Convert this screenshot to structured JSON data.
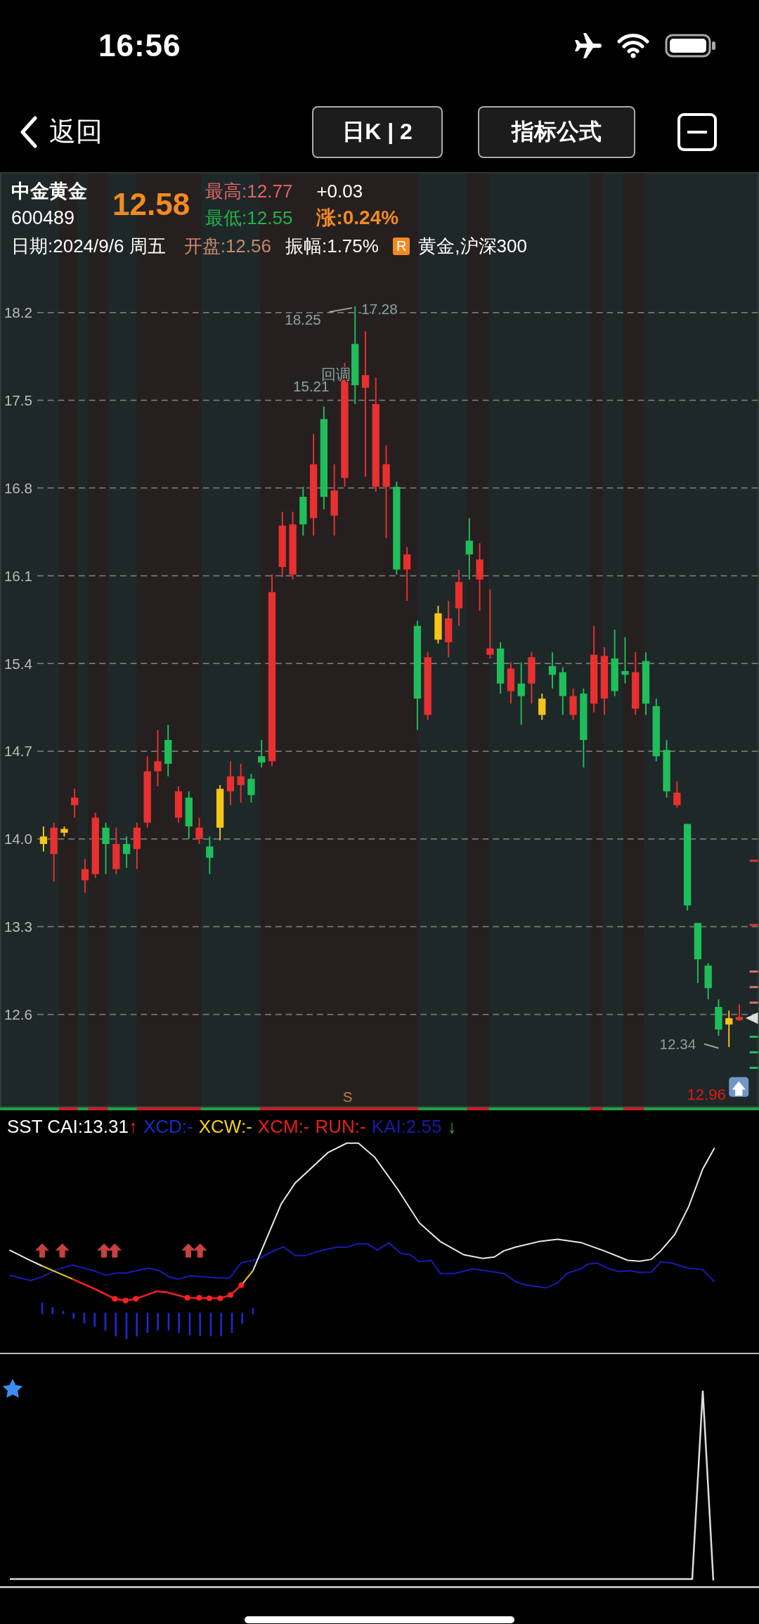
{
  "status_bar": {
    "time": "16:56"
  },
  "nav": {
    "back": "返回",
    "period_button": "日K | 2",
    "formula_button": "指标公式"
  },
  "quote": {
    "name": "中金黄金",
    "code": "600489",
    "price": "12.58",
    "high": "最高:12.77",
    "change": "+0.03",
    "low": "最低:12.55",
    "change_pct": "涨:0.24%",
    "date": "日期:2024/9/6 周五",
    "open": "开盘:12.56",
    "amplitude": "振幅:1.75%",
    "tag": "R",
    "sectors": "黄金,沪深300"
  },
  "price_chart": {
    "annotations": [
      "18.25",
      "17.28",
      "回调",
      "15.21",
      "12.34"
    ],
    "marker": "S",
    "last_label": "12.96",
    "chart_data": {
      "type": "candlestick",
      "yticks": [
        {
          "value": 18.2,
          "label": "18.2"
        },
        {
          "value": 17.5,
          "label": "17.5"
        },
        {
          "value": 16.8,
          "label": "16.8"
        },
        {
          "value": 16.1,
          "label": "16.1"
        },
        {
          "value": 15.4,
          "label": "15.4"
        },
        {
          "value": 14.7,
          "label": "14.7"
        },
        {
          "value": 14,
          "label": "14.0"
        },
        {
          "value": 13.3,
          "label": "13.3"
        },
        {
          "value": 12.6,
          "label": "12.6"
        }
      ],
      "grid": true,
      "ylim": [
        11.86,
        19.32
      ],
      "ohlc": [
        [
          13.96,
          14.1,
          13.9,
          14.02
        ],
        [
          13.88,
          14.13,
          13.66,
          14.09
        ],
        [
          14.05,
          14.1,
          14.02,
          14.08
        ],
        [
          14.27,
          14.4,
          14.17,
          14.33
        ],
        [
          13.67,
          13.84,
          13.57,
          13.76
        ],
        [
          13.72,
          14.21,
          13.69,
          14.17
        ],
        [
          14.09,
          14.13,
          13.72,
          13.96
        ],
        [
          13.76,
          14.09,
          13.72,
          13.96
        ],
        [
          13.96,
          14.02,
          13.77,
          13.88
        ],
        [
          13.92,
          14.13,
          13.76,
          14.09
        ],
        [
          14.13,
          14.66,
          14.09,
          14.54
        ],
        [
          14.54,
          14.87,
          14.42,
          14.62
        ],
        [
          14.79,
          14.91,
          14.5,
          14.6
        ],
        [
          14.17,
          14.42,
          14.13,
          14.38
        ],
        [
          14.33,
          14.38,
          14.0,
          14.1
        ],
        [
          14.0,
          14.17,
          13.96,
          14.09
        ],
        [
          13.94,
          14.02,
          13.72,
          13.85
        ],
        [
          14.09,
          14.43,
          13.99,
          14.4
        ],
        [
          14.38,
          14.62,
          14.27,
          14.5
        ],
        [
          14.43,
          14.6,
          14.29,
          14.5
        ],
        [
          14.48,
          14.52,
          14.29,
          14.35
        ],
        [
          14.66,
          14.79,
          14.57,
          14.61
        ],
        [
          14.62,
          16.11,
          14.58,
          15.97
        ],
        [
          16.17,
          16.61,
          16.09,
          16.5
        ],
        [
          16.11,
          16.61,
          16.07,
          16.51
        ],
        [
          16.73,
          16.81,
          16.42,
          16.51
        ],
        [
          16.56,
          17.23,
          16.42,
          16.99
        ],
        [
          17.35,
          17.45,
          16.63,
          16.73
        ],
        [
          16.58,
          16.99,
          16.42,
          16.78
        ],
        [
          16.88,
          17.8,
          16.81,
          17.7
        ],
        [
          17.95,
          18.25,
          17.47,
          17.62
        ],
        [
          17.6,
          18.05,
          16.89,
          17.7
        ],
        [
          16.81,
          17.68,
          16.77,
          17.47
        ],
        [
          16.81,
          17.14,
          16.4,
          16.99
        ],
        [
          16.81,
          16.85,
          16.11,
          16.15
        ],
        [
          16.15,
          16.33,
          15.9,
          16.27
        ],
        [
          15.7,
          15.74,
          14.87,
          15.12
        ],
        [
          14.99,
          15.49,
          14.95,
          15.45
        ],
        [
          15.59,
          15.86,
          15.56,
          15.8
        ],
        [
          15.57,
          15.9,
          15.45,
          15.76
        ],
        [
          15.84,
          16.15,
          15.7,
          16.05
        ],
        [
          16.38,
          16.56,
          16.07,
          16.27
        ],
        [
          16.07,
          16.36,
          15.82,
          16.23
        ],
        [
          15.47,
          15.99,
          15.44,
          15.52
        ],
        [
          15.52,
          15.57,
          15.16,
          15.24
        ],
        [
          15.18,
          15.41,
          15.08,
          15.36
        ],
        [
          15.24,
          15.41,
          14.91,
          15.14
        ],
        [
          15.24,
          15.49,
          15.08,
          15.45
        ],
        [
          14.99,
          15.16,
          14.95,
          15.12
        ],
        [
          15.38,
          15.49,
          15.2,
          15.31
        ],
        [
          15.33,
          15.37,
          14.99,
          15.14
        ],
        [
          14.99,
          15.2,
          14.95,
          15.14
        ],
        [
          15.16,
          15.2,
          14.57,
          14.79
        ],
        [
          15.08,
          15.7,
          15.01,
          15.47
        ],
        [
          15.12,
          15.53,
          14.99,
          15.46
        ],
        [
          15.44,
          15.67,
          15.14,
          15.18
        ],
        [
          15.34,
          15.61,
          15.24,
          15.31
        ],
        [
          15.04,
          15.49,
          14.99,
          15.33
        ],
        [
          15.42,
          15.49,
          14.99,
          15.08
        ],
        [
          15.06,
          15.12,
          14.62,
          14.66
        ],
        [
          14.71,
          14.79,
          14.33,
          14.38
        ],
        [
          14.27,
          14.46,
          14.25,
          14.37
        ],
        [
          14.12,
          14.12,
          13.43,
          13.47
        ],
        [
          13.33,
          13.33,
          12.85,
          13.04
        ],
        [
          12.99,
          13.01,
          12.72,
          12.81
        ],
        [
          12.66,
          12.72,
          12.43,
          12.48
        ],
        [
          12.52,
          12.63,
          12.34,
          12.57
        ],
        [
          12.56,
          12.68,
          12.55,
          12.58
        ]
      ],
      "colors": [
        "#f5c518",
        "#e83030",
        "#f5c518",
        "#e83030",
        "#e83030",
        "#e83030",
        "#1fbe5a",
        "#e83030",
        "#1fbe5a",
        "#e83030",
        "#e83030",
        "#e83030",
        "#1fbe5a",
        "#e83030",
        "#1fbe5a",
        "#e83030",
        "#1fbe5a",
        "#f5c518",
        "#e83030",
        "#e83030",
        "#1fbe5a",
        "#1fbe5a",
        "#e83030",
        "#e83030",
        "#e83030",
        "#1fbe5a",
        "#e83030",
        "#1fbe5a",
        "#e83030",
        "#e83030",
        "#1fbe5a",
        "#e83030",
        "#e83030",
        "#e83030",
        "#1fbe5a",
        "#e83030",
        "#1fbe5a",
        "#e83030",
        "#f5c518",
        "#e83030",
        "#e83030",
        "#1fbe5a",
        "#e83030",
        "#e83030",
        "#1fbe5a",
        "#e83030",
        "#1fbe5a",
        "#e83030",
        "#f5c518",
        "#1fbe5a",
        "#1fbe5a",
        "#e83030",
        "#1fbe5a",
        "#e83030",
        "#e83030",
        "#1fbe5a",
        "#1fbe5a",
        "#e83030",
        "#1fbe5a",
        "#1fbe5a",
        "#1fbe5a",
        "#e83030",
        "#1fbe5a",
        "#1fbe5a",
        "#1fbe5a",
        "#1fbe5a",
        "#f5c518",
        "#e83030"
      ]
    }
  },
  "indicator": {
    "legend": [
      {
        "text": "SST CAI:13.31",
        "color": "#ffffff"
      },
      {
        "text": "↑",
        "color": "#e02020"
      },
      {
        "text": "XCD:-",
        "color": "#1a2ad0"
      },
      {
        "text": "XCW:-",
        "color": "#f0d020"
      },
      {
        "text": "XCM:-",
        "color": "#e82020"
      },
      {
        "text": "RUN:-",
        "color": "#e82020"
      },
      {
        "text": "KAI:2.55",
        "color": "#1a1aa8"
      },
      {
        "text": "↓",
        "color": "#22b04a"
      }
    ]
  }
}
